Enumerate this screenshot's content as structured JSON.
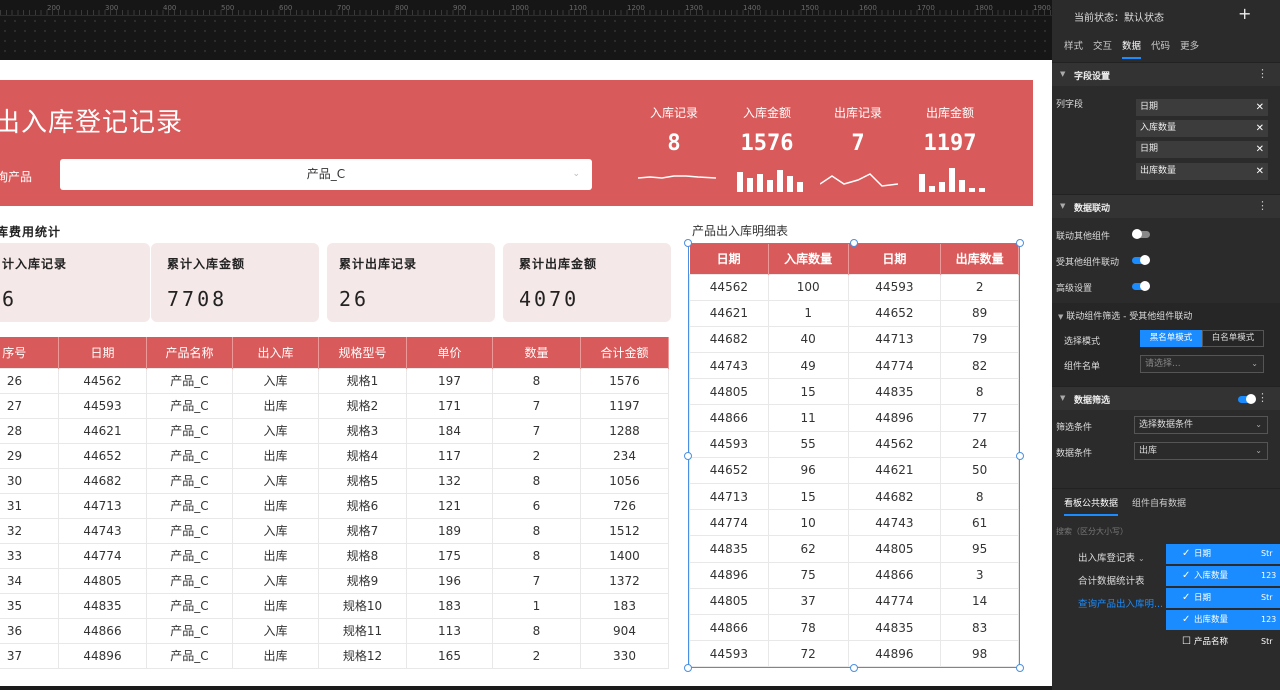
{
  "ruler": {
    "labels": [
      "200",
      "300",
      "400",
      "500",
      "600",
      "700",
      "800",
      "900",
      "1000",
      "1100",
      "1200",
      "1300",
      "1400",
      "1500",
      "1600",
      "1700",
      "1800",
      "1900"
    ]
  },
  "banner": {
    "title": "出入库登记记录",
    "query_label": "询产品",
    "select_value": "产品_C",
    "kpis": [
      {
        "label": "入库记录",
        "value": "8"
      },
      {
        "label": "入库金额",
        "value": "1576"
      },
      {
        "label": "出库记录",
        "value": "7"
      },
      {
        "label": "出库金额",
        "value": "1197"
      }
    ]
  },
  "stats": {
    "section_title": "库费用统计",
    "cards": [
      {
        "label": "计入库记录",
        "value": "6"
      },
      {
        "label": "累计入库金额",
        "value": "7708"
      },
      {
        "label": "累计出库记录",
        "value": "26"
      },
      {
        "label": "累计出库金额",
        "value": "4070"
      }
    ]
  },
  "left_table": {
    "headers": [
      "序号",
      "日期",
      "产品名称",
      "出入库",
      "规格型号",
      "单价",
      "数量",
      "合计金额"
    ],
    "rows": [
      [
        "26",
        "44562",
        "产品_C",
        "入库",
        "规格1",
        "197",
        "8",
        "1576"
      ],
      [
        "27",
        "44593",
        "产品_C",
        "出库",
        "规格2",
        "171",
        "7",
        "1197"
      ],
      [
        "28",
        "44621",
        "产品_C",
        "入库",
        "规格3",
        "184",
        "7",
        "1288"
      ],
      [
        "29",
        "44652",
        "产品_C",
        "出库",
        "规格4",
        "117",
        "2",
        "234"
      ],
      [
        "30",
        "44682",
        "产品_C",
        "入库",
        "规格5",
        "132",
        "8",
        "1056"
      ],
      [
        "31",
        "44713",
        "产品_C",
        "出库",
        "规格6",
        "121",
        "6",
        "726"
      ],
      [
        "32",
        "44743",
        "产品_C",
        "入库",
        "规格7",
        "189",
        "8",
        "1512"
      ],
      [
        "33",
        "44774",
        "产品_C",
        "出库",
        "规格8",
        "175",
        "8",
        "1400"
      ],
      [
        "34",
        "44805",
        "产品_C",
        "入库",
        "规格9",
        "196",
        "7",
        "1372"
      ],
      [
        "35",
        "44835",
        "产品_C",
        "出库",
        "规格10",
        "183",
        "1",
        "183"
      ],
      [
        "36",
        "44866",
        "产品_C",
        "入库",
        "规格11",
        "113",
        "8",
        "904"
      ],
      [
        "37",
        "44896",
        "产品_C",
        "出库",
        "规格12",
        "165",
        "2",
        "330"
      ]
    ]
  },
  "right_table": {
    "title": "产品出入库明细表",
    "headers": [
      "日期",
      "入库数量",
      "日期",
      "出库数量"
    ],
    "rows": [
      [
        "44562",
        "100",
        "44593",
        "2"
      ],
      [
        "44621",
        "1",
        "44652",
        "89"
      ],
      [
        "44682",
        "40",
        "44713",
        "79"
      ],
      [
        "44743",
        "49",
        "44774",
        "82"
      ],
      [
        "44805",
        "15",
        "44835",
        "8"
      ],
      [
        "44866",
        "11",
        "44896",
        "77"
      ],
      [
        "44593",
        "55",
        "44562",
        "24"
      ],
      [
        "44652",
        "96",
        "44621",
        "50"
      ],
      [
        "44713",
        "15",
        "44682",
        "8"
      ],
      [
        "44774",
        "10",
        "44743",
        "61"
      ],
      [
        "44835",
        "62",
        "44805",
        "95"
      ],
      [
        "44896",
        "75",
        "44866",
        "3"
      ],
      [
        "44805",
        "37",
        "44774",
        "14"
      ],
      [
        "44866",
        "78",
        "44835",
        "83"
      ],
      [
        "44593",
        "72",
        "44896",
        "98"
      ]
    ]
  },
  "panel": {
    "state": "当前状态：默认状态",
    "plus": "+",
    "menu": "⋮",
    "tabs": [
      "样式",
      "交互",
      "数据",
      "代码",
      "更多"
    ],
    "field_section": "字段设置",
    "column_fields_label": "列字段",
    "column_fields": [
      "日期",
      "入库数量",
      "日期",
      "出库数量"
    ],
    "link_section": "数据联动",
    "link_other": "联动其他组件",
    "linked_by_other": "受其他组件联动",
    "advanced": "高级设置",
    "filter_sub": "联动组件筛选 - 受其他组件联动",
    "select_mode_label": "选择模式",
    "blacklist": "黑名单模式",
    "whitelist": "白名单模式",
    "component_names_label": "组件名单",
    "component_names_placeholder": "请选择...",
    "data_filter_section": "数据筛选",
    "filter_cond_label": "筛选条件",
    "filter_cond_value": "选择数据条件",
    "data_cond_label": "数据条件",
    "data_cond_value": "出库",
    "bottom_tabs": [
      "看板公共数据",
      "组件自有数据"
    ],
    "search_hint": "搜索（区分大小写）",
    "tree_items": [
      "出入库登记表",
      "合计数据统计表",
      "查询产品出入库明..."
    ],
    "fields": [
      {
        "name": "日期",
        "type": "Str",
        "checked": true
      },
      {
        "name": "入库数量",
        "type": "123",
        "checked": true
      },
      {
        "name": "日期",
        "type": "Str",
        "checked": true
      },
      {
        "name": "出库数量",
        "type": "123",
        "checked": true
      },
      {
        "name": "产品名称",
        "type": "Str",
        "checked": false
      }
    ]
  },
  "colors": {
    "accent": "#d95a5a",
    "selection": "#4a90e2",
    "panel_blue": "#1a8cff"
  }
}
